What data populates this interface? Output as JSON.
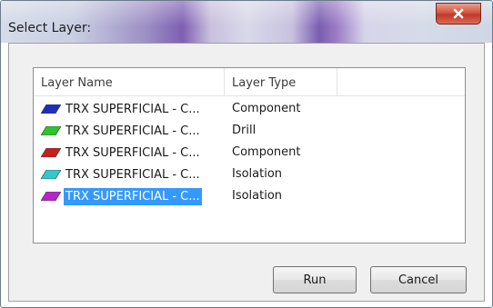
{
  "window": {
    "title": "Select Layer:",
    "close_glyph": "✕"
  },
  "list": {
    "columns": [
      "Layer Name",
      "Layer Type"
    ],
    "rows": [
      {
        "name": "TRX SUPERFICIAL - C...",
        "type": "Component",
        "color": "#1f2fb8",
        "selected": false
      },
      {
        "name": "TRX SUPERFICIAL - C...",
        "type": "Drill",
        "color": "#2ec42e",
        "selected": false
      },
      {
        "name": "TRX SUPERFICIAL - C...",
        "type": "Component",
        "color": "#c42020",
        "selected": false
      },
      {
        "name": "TRX SUPERFICIAL - C...",
        "type": "Isolation",
        "color": "#34c8c8",
        "selected": false
      },
      {
        "name": "TRX SUPERFICIAL - C...",
        "type": "Isolation",
        "color": "#b428c8",
        "selected": true
      }
    ]
  },
  "buttons": {
    "run_label": "Run",
    "cancel_label": "Cancel"
  },
  "colors": {
    "selection": "#3399ff"
  }
}
